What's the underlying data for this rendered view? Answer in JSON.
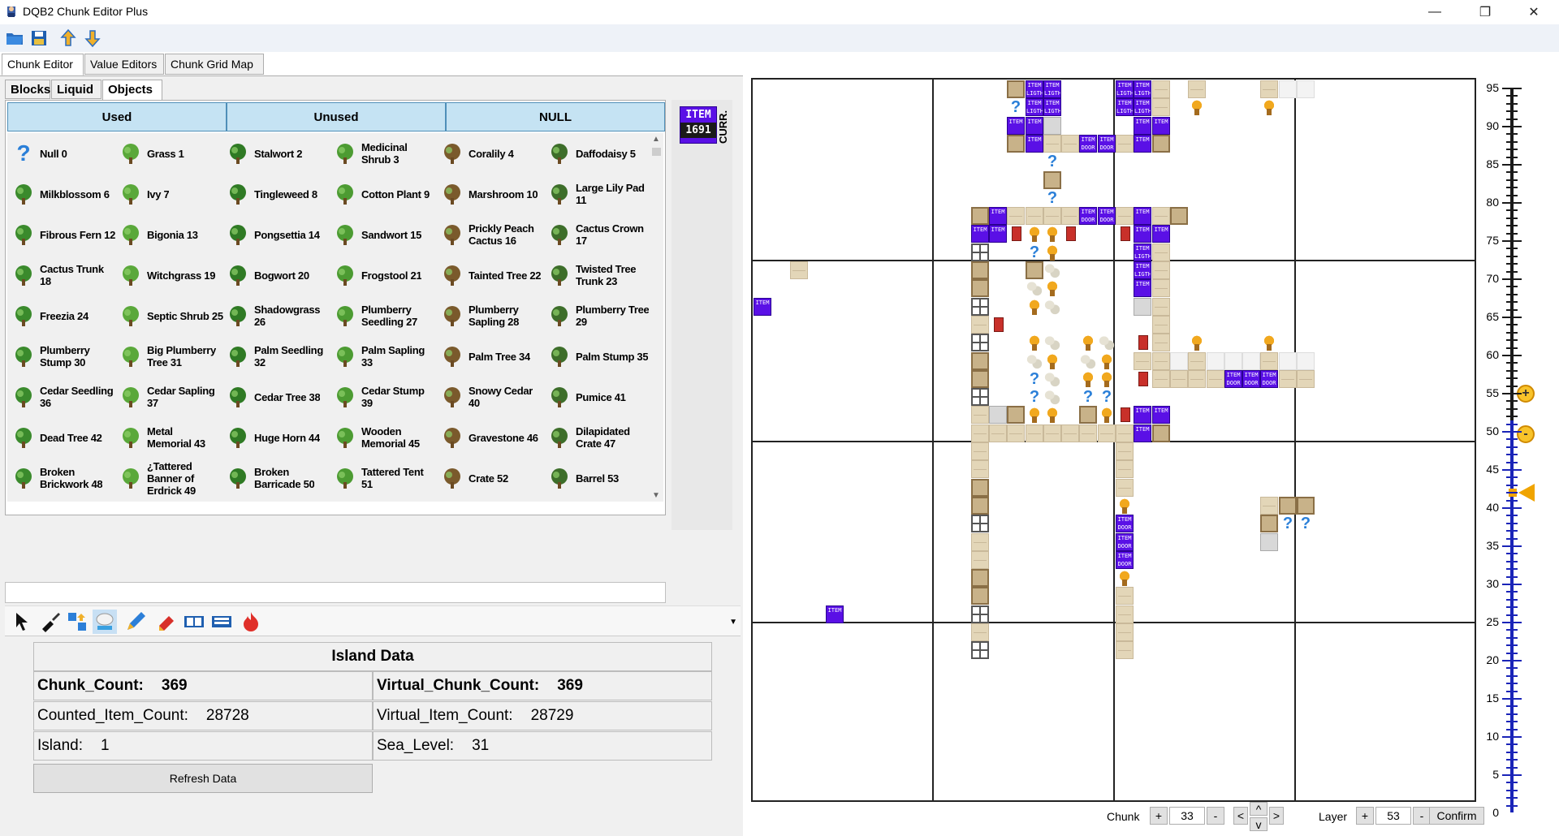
{
  "window": {
    "title": "DQB2 Chunk Editor Plus"
  },
  "main_tabs": [
    "Chunk Editor",
    "Value Editors",
    "Chunk Grid Map"
  ],
  "sub_tabs": [
    "Blocks",
    "Liquid",
    "Objects"
  ],
  "object_headers": [
    "Used",
    "Unused",
    "NULL"
  ],
  "objects": [
    [
      "Null 0",
      "Grass 1",
      "Stalwort 2",
      "Medicinal\nShrub 3",
      "Coralily 4",
      "Daffodaisy 5"
    ],
    [
      "Milkblossom 6",
      "Ivy 7",
      "Tingleweed 8",
      "Cotton Plant 9",
      "Marshroom 10",
      "Large Lily Pad\n11"
    ],
    [
      "Fibrous Fern 12",
      "Bigonia 13",
      "Pongsettia 14",
      "Sandwort 15",
      "Prickly Peach\nCactus 16",
      "Cactus Crown\n17"
    ],
    [
      "Cactus Trunk 18",
      "Witchgrass 19",
      "Bogwort 20",
      "Frogstool 21",
      "Tainted Tree 22",
      "Twisted Tree\nTrunk 23"
    ],
    [
      "Freezia 24",
      "Septic Shrub 25",
      "Shadowgrass\n26",
      "Plumberry\nSeedling 27",
      "Plumberry\nSapling 28",
      "Plumberry Tree\n29"
    ],
    [
      "Plumberry\nStump 30",
      "Big Plumberry\nTree 31",
      "Palm Seedling\n32",
      "Palm Sapling\n33",
      "Palm Tree 34",
      "Palm Stump 35"
    ],
    [
      "Cedar Seedling\n36",
      "Cedar Sapling\n37",
      "Cedar Tree 38",
      "Cedar Stump 39",
      "Snowy Cedar\n40",
      "Pumice 41"
    ],
    [
      "Dead Tree 42",
      "Metal\nMemorial 43",
      "Huge Horn 44",
      "Wooden\nMemorial 45",
      "Gravestone 46",
      "Dilapidated\nCrate 47"
    ],
    [
      "Broken\nBrickwork 48",
      "¿Tattered\nBanner of\nErdrick 49",
      "Broken\nBarricade 50",
      "Tattered Tent\n51",
      "Crate 52",
      "Barrel 53"
    ]
  ],
  "current_item": {
    "line1": "ITEM",
    "line2": "1691",
    "label": "CURR."
  },
  "island_data": {
    "title": "Island Data",
    "chunk_count_label": "Chunk_Count:",
    "chunk_count": "369",
    "virtual_chunk_count_label": "Virtual_Chunk_Count:",
    "virtual_chunk_count": "369",
    "counted_item_count_label": "Counted_Item_Count:",
    "counted_item_count": "28728",
    "virtual_item_count_label": "Virtual_Item_Count:",
    "virtual_item_count": "28729",
    "island_label": "Island:",
    "island": "1",
    "sea_level_label": "Sea_Level:",
    "sea_level": "31",
    "refresh_label": "Refresh Data"
  },
  "map_labels": {
    "item": "ITEM",
    "lgth": "LIGTH",
    "door": "DOOR",
    "unknown": "?"
  },
  "layer_ruler": {
    "labels": [
      "95",
      "90",
      "85",
      "80",
      "75",
      "70",
      "65",
      "60",
      "55",
      "50",
      "45",
      "40",
      "35",
      "30",
      "25",
      "20",
      "15",
      "10",
      "5",
      "0"
    ],
    "plus": "+",
    "minus": "-"
  },
  "bottom": {
    "chunk_label": "Chunk",
    "chunk_value": "33",
    "layer_label": "Layer",
    "layer_value": "53",
    "plus": "+",
    "minus": "-",
    "left": "<",
    "right": ">",
    "up": "^",
    "down": "v",
    "confirm": "Confirm"
  }
}
